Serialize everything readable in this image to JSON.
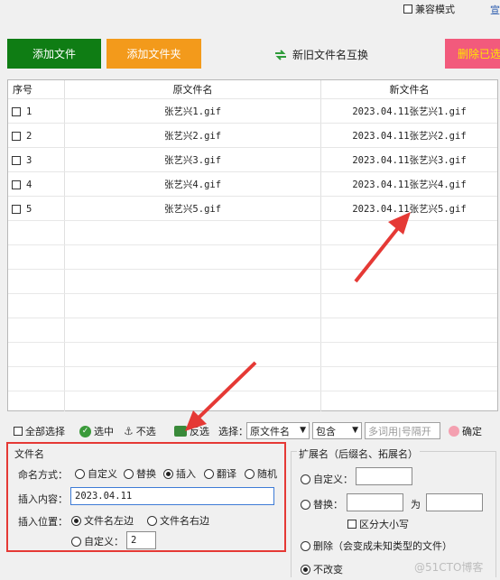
{
  "topbar": {
    "compat_label": "兼容模式",
    "corner_text": "宣"
  },
  "buttons": {
    "add_file": "添加文件",
    "add_folder": "添加文件夹",
    "swap": "新旧文件名互换",
    "delete": "删除已选",
    "add_file_color": "#0f7d14",
    "add_folder_color": "#f39a1b",
    "delete_color": "#f25a7c"
  },
  "table": {
    "headers": [
      "序号",
      "原文件名",
      "新文件名"
    ],
    "rows": [
      {
        "index": "1",
        "original": "张艺兴1.gif",
        "new": "2023.04.11张艺兴1.gif"
      },
      {
        "index": "2",
        "original": "张艺兴2.gif",
        "new": "2023.04.11张艺兴2.gif"
      },
      {
        "index": "3",
        "original": "张艺兴3.gif",
        "new": "2023.04.11张艺兴3.gif"
      },
      {
        "index": "4",
        "original": "张艺兴4.gif",
        "new": "2023.04.11张艺兴4.gif"
      },
      {
        "index": "5",
        "original": "张艺兴5.gif",
        "new": "2023.04.11张艺兴5.gif"
      }
    ]
  },
  "toolbar": {
    "select_all": "全部选择",
    "select_mid": "选中",
    "deselect": "不选",
    "invert": "反选",
    "choose_label": "选择：",
    "field_select": "原文件名",
    "mode_select": "包含",
    "keyword_placeholder": "多词用|号隔开",
    "confirm": "确定"
  },
  "filename_panel": {
    "title": "文件名",
    "naming_label": "命名方式：",
    "naming_options": [
      "自定义",
      "替换",
      "插入",
      "翻译",
      "随机"
    ],
    "naming_selected": "插入",
    "insert_content_label": "插入内容：",
    "insert_content_value": "2023.04.11",
    "insert_pos_label": "插入位置：",
    "pos_left": "文件名左边",
    "pos_right": "文件名右边",
    "pos_custom": "自定义：",
    "pos_custom_value": "2",
    "pos_selected": "文件名左边"
  },
  "ext_panel": {
    "title": "扩展名（后缀名、拓展名）",
    "custom": "自定义：",
    "replace": "替换：",
    "replace_for": "为",
    "case_sensitive": "区分大小写",
    "delete": "删除（会变成未知类型的文件）",
    "keep": "不改变",
    "selected": "不改变"
  },
  "watermark": "@51CTO博客",
  "annotation_color": "#e53935"
}
